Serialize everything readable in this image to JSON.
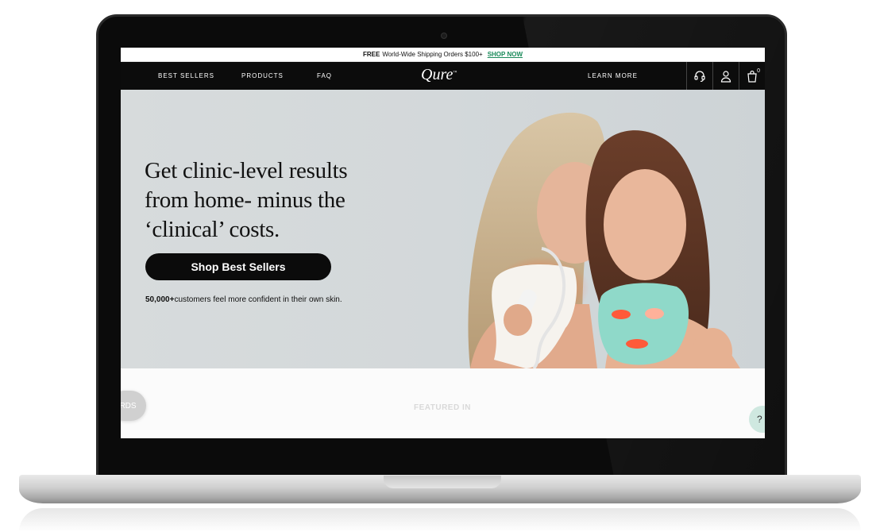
{
  "announcement": {
    "free": "FREE",
    "text": "World-Wide Shipping Orders $100+",
    "link": "SHOP NOW"
  },
  "nav": {
    "best_sellers": "BEST SELLERS",
    "products": "PRODUCTS",
    "faq": "FAQ",
    "logo": "Qure",
    "logo_tm": "™",
    "learn_more": "LEARN MORE",
    "cart_count": "0",
    "icons": [
      "headset-icon",
      "user-icon",
      "cart-icon"
    ]
  },
  "hero": {
    "title_line1": "Get clinic-level results",
    "title_line2": "from home- minus the",
    "title_line3": "‘clinical’ costs.",
    "cta": "Shop Best Sellers",
    "sub_bold": "50,000+",
    "sub_text": "customers feel more confident in their own skin."
  },
  "featured": {
    "label": "FEATURED IN",
    "rewards_tab": "RDS",
    "help": "?"
  },
  "colors": {
    "nav_bg": "#0c0c0c",
    "accent_link": "#1a8a5a",
    "hero_bg": "#d5d9db",
    "mask": "#8fd9c9"
  }
}
